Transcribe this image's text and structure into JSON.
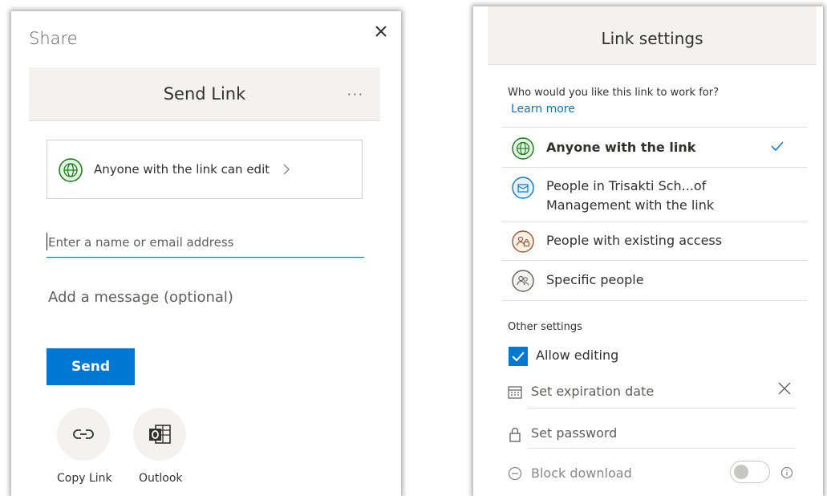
{
  "share": {
    "title": "Share",
    "header_title": "Send Link",
    "more": "···",
    "link_option_label": "Anyone with the link can edit",
    "email_placeholder": "Enter a name or email address",
    "message_placeholder": "Add a message (optional)",
    "send_label": "Send",
    "actions": [
      {
        "label": "Copy Link",
        "icon": "link-icon"
      },
      {
        "label": "Outlook",
        "icon": "outlook-icon"
      }
    ]
  },
  "link_settings": {
    "title": "Link settings",
    "question": "Who would you like this link to work for?",
    "learn_more": "Learn more",
    "options": [
      {
        "label": "Anyone with the link",
        "icon": "globe-icon",
        "selected": true
      },
      {
        "label_line1": "People in Trisakti Sch...of",
        "label_line2": "Management with the link",
        "icon": "organization-icon",
        "selected": false
      },
      {
        "label": "People with existing access",
        "icon": "people-lock-icon",
        "selected": false
      },
      {
        "label": "Specific people",
        "icon": "people-icon",
        "selected": false
      }
    ],
    "other_settings_label": "Other settings",
    "allow_editing": {
      "label": "Allow editing",
      "checked": true
    },
    "expiration_label": "Set expiration date",
    "password_label": "Set password",
    "block_download": {
      "label": "Block download",
      "enabled": false
    }
  },
  "colors": {
    "accent": "#0078d4",
    "globe_green": "#107c10",
    "org_blue": "#0078d4",
    "people_orange": "#a0522d"
  }
}
